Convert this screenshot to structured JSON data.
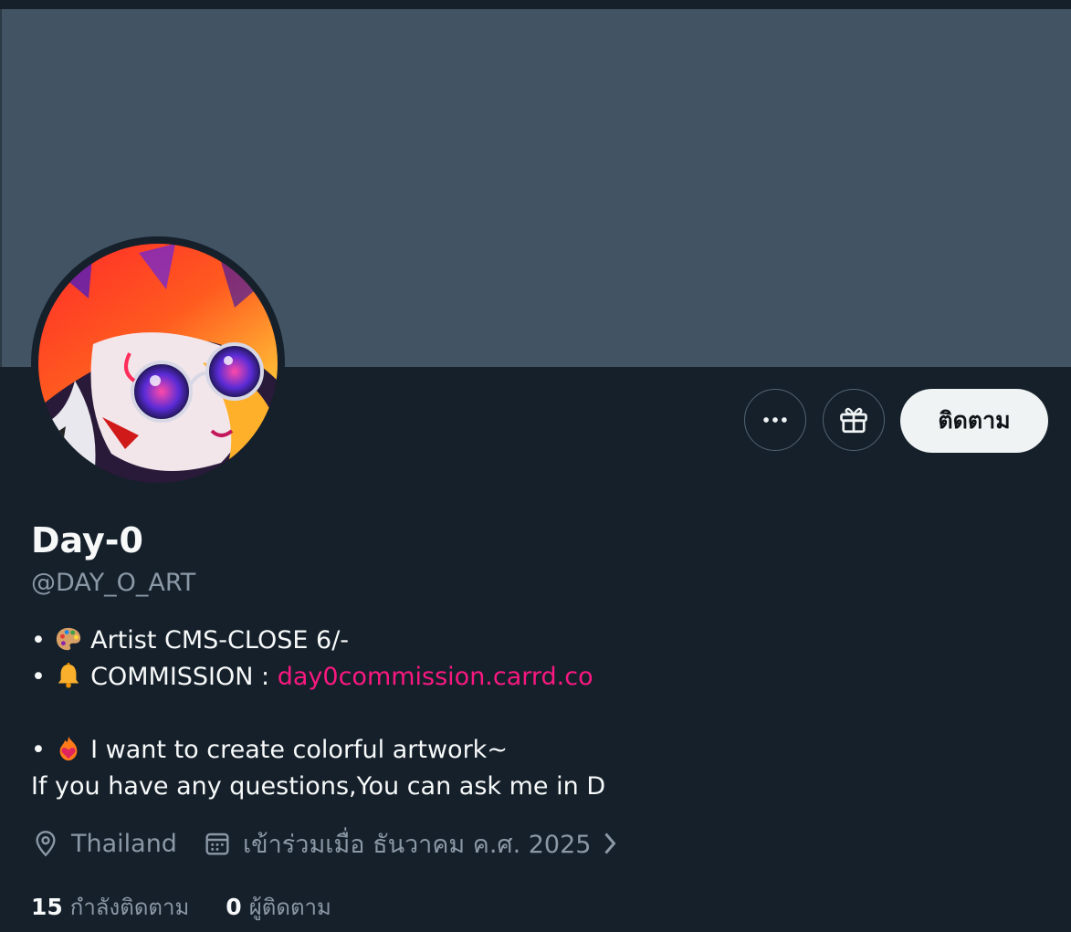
{
  "profile": {
    "display_name": "Day-0",
    "handle": "@DAY_O_ART",
    "avatar_icon": "profile-avatar"
  },
  "actions": {
    "more_icon": "more-horizontal-icon",
    "gift_icon": "gift-icon",
    "follow_label": "ติดตาม"
  },
  "bio": {
    "line1": {
      "bullet": "•",
      "emoji": "palette-emoji",
      "text": "Artist CMS-CLOSE 6/-"
    },
    "line2": {
      "bullet": "•",
      "emoji": "bell-emoji",
      "text": "COMMISSION : ",
      "link": "day0commission.carrd.co"
    },
    "line3": {
      "bullet": "•",
      "emoji": "fire-heart-emoji",
      "text": " I want to create colorful artwork~"
    },
    "line4": {
      "text": "If you have any questions,You can ask me in D"
    }
  },
  "meta": {
    "location_icon": "location-pin-icon",
    "location": "Thailand",
    "joined_icon": "calendar-icon",
    "joined": "เข้าร่วมเมื่อ ธันวาคม ค.ศ. 2025",
    "chevron_icon": "chevron-right-icon"
  },
  "stats": {
    "following_count": "15",
    "following_label": "กำลังติดตาม",
    "followers_count": "0",
    "followers_label": "ผู้ติดตาม"
  },
  "colors": {
    "background": "#15202b",
    "banner": "#425364",
    "link": "#f91880",
    "secondary_text": "#8b98a5",
    "follow_button_bg": "#eff3f4"
  }
}
